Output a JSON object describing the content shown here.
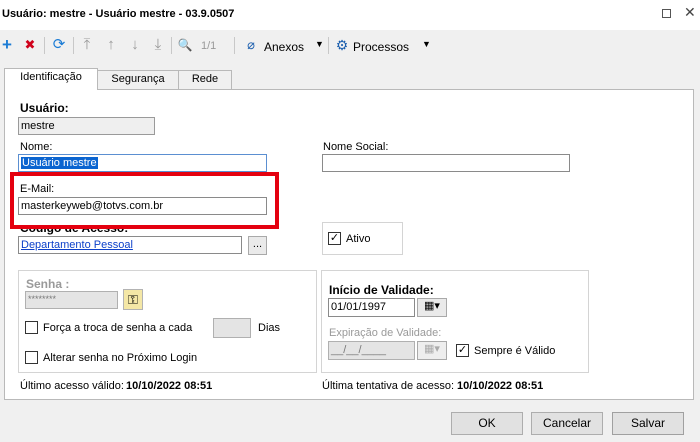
{
  "window": {
    "title": "Usuário: mestre - Usuário mestre - 03.9.0507"
  },
  "toolbar": {
    "add": "+",
    "delete": "✖",
    "refresh": "⟳",
    "first": "⤒",
    "prev": "↑",
    "next": "↓",
    "last": "⤓",
    "search": "🔍",
    "pager": "1/1",
    "anexos_label": "Anexos",
    "processos_label": "Processos"
  },
  "tabs": [
    {
      "label": "Identificação",
      "active": true
    },
    {
      "label": "Segurança",
      "active": false
    },
    {
      "label": "Rede",
      "active": false
    }
  ],
  "form": {
    "usuario_label": "Usuário:",
    "usuario_value": "mestre",
    "nome_label": "Nome:",
    "nome_value": "Usuário mestre",
    "nome_social_label": "Nome Social:",
    "nome_social_value": "",
    "email_label": "E-Mail:",
    "email_value": "masterkeyweb@totvs.com.br",
    "codigo_acesso_label": "Código de Acesso:",
    "codigo_acesso_value": "Departamento Pessoal",
    "browse_label": "...",
    "ativo_label": "Ativo",
    "ativo_checked": "✓",
    "senha_label": "Senha :",
    "senha_value": "********",
    "forca_troca_label": "Força a troca de senha a cada",
    "forca_dias_value": "",
    "dias_label": "Dias",
    "alterar_senha_label": "Alterar senha no Próximo Login",
    "inicio_validade_label": "Início de Validade:",
    "inicio_validade_value": "01/01/1997",
    "expiracao_label": "Expiração de Validade:",
    "expiracao_value": "__/__/____",
    "sempre_valido_label": "Sempre é Válido",
    "sempre_valido_checked": "✓",
    "ultimo_acesso_label": "Último acesso válido:",
    "ultimo_acesso_value": "10/10/2022 08:51",
    "ultima_tentativa_label": "Última tentativa de acesso:",
    "ultima_tentativa_value": "10/10/2022 08:51"
  },
  "footer": {
    "ok_label": "OK",
    "cancel_label": "Cancelar",
    "save_label": "Salvar"
  },
  "colors": {
    "highlight": "#e4000f",
    "selection": "#0a64d0",
    "add_icon": "#1c7cd5",
    "delete_icon": "#d0021b"
  }
}
